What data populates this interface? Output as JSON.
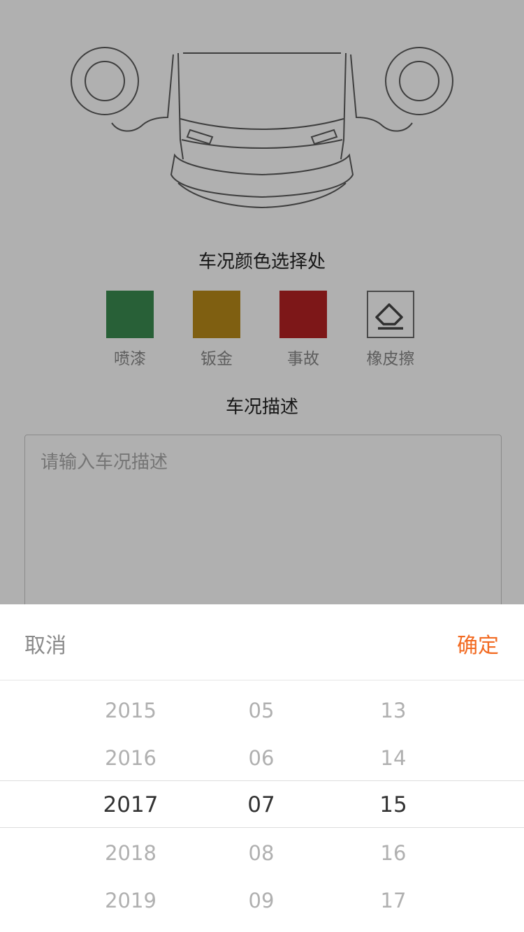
{
  "color_section": {
    "title": "车况颜色选择处",
    "options": [
      {
        "label": "喷漆",
        "color": "#3a8c50"
      },
      {
        "label": "钣金",
        "color": "#b88a1a"
      },
      {
        "label": "事故",
        "color": "#b52223"
      },
      {
        "label": "橡皮擦",
        "icon": "eraser-icon"
      }
    ]
  },
  "description": {
    "title": "车况描述",
    "placeholder": "请输入车况描述"
  },
  "date_picker": {
    "cancel_label": "取消",
    "confirm_label": "确定",
    "accent_color": "#f26a21",
    "years": [
      "2015",
      "2016",
      "2017",
      "2018",
      "2019"
    ],
    "months": [
      "05",
      "06",
      "07",
      "08",
      "09"
    ],
    "days": [
      "13",
      "14",
      "15",
      "16",
      "17"
    ],
    "selected": {
      "year": "2017",
      "month": "07",
      "day": "15"
    }
  }
}
